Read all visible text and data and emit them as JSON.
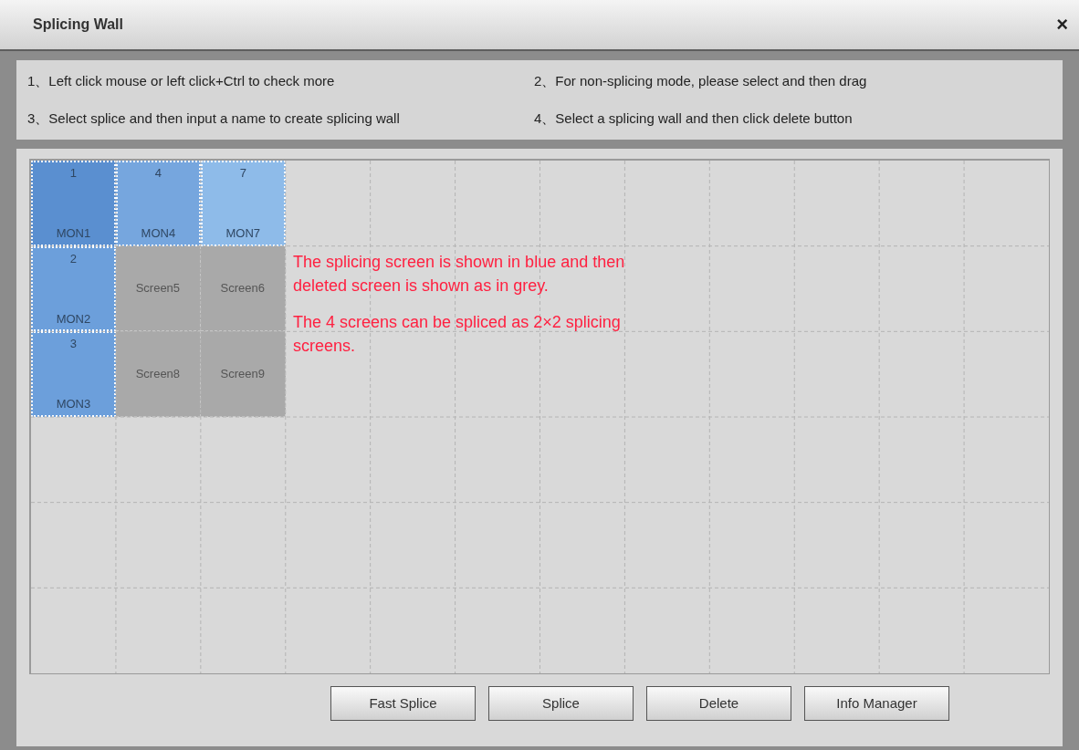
{
  "window": {
    "title": "Splicing Wall",
    "close": "×"
  },
  "instructions": [
    "1、Left click mouse or left click+Ctrl to check more",
    "2、For non-splicing mode, please select and then drag",
    "3、Select splice and then input a name to create splicing wall",
    "4、Select a splicing wall and then click delete button"
  ],
  "wall": {
    "rows": [
      [
        {
          "kind": "monitor",
          "number": "1",
          "name": "MON1",
          "color": "#5a8fd0"
        },
        {
          "kind": "monitor",
          "number": "4",
          "name": "MON4",
          "color": "#76a6de"
        },
        {
          "kind": "monitor",
          "number": "7",
          "name": "MON7",
          "color": "#8ebbe9"
        }
      ],
      [
        {
          "kind": "monitor",
          "number": "2",
          "name": "MON2",
          "color": "#6c9fdb"
        },
        {
          "kind": "screen",
          "name": "Screen5"
        },
        {
          "kind": "screen",
          "name": "Screen6"
        }
      ],
      [
        {
          "kind": "monitor",
          "number": "3",
          "name": "MON3",
          "color": "#6c9fdb"
        },
        {
          "kind": "screen",
          "name": "Screen8"
        },
        {
          "kind": "screen",
          "name": "Screen9"
        }
      ]
    ],
    "notes": [
      "The splicing screen is shown in blue and then deleted screen is shown as in grey.",
      "The 4 screens can be spliced as 2×2 splicing screens."
    ]
  },
  "buttons": [
    "Fast Splice",
    "Splice",
    "Delete",
    "Info Manager"
  ]
}
